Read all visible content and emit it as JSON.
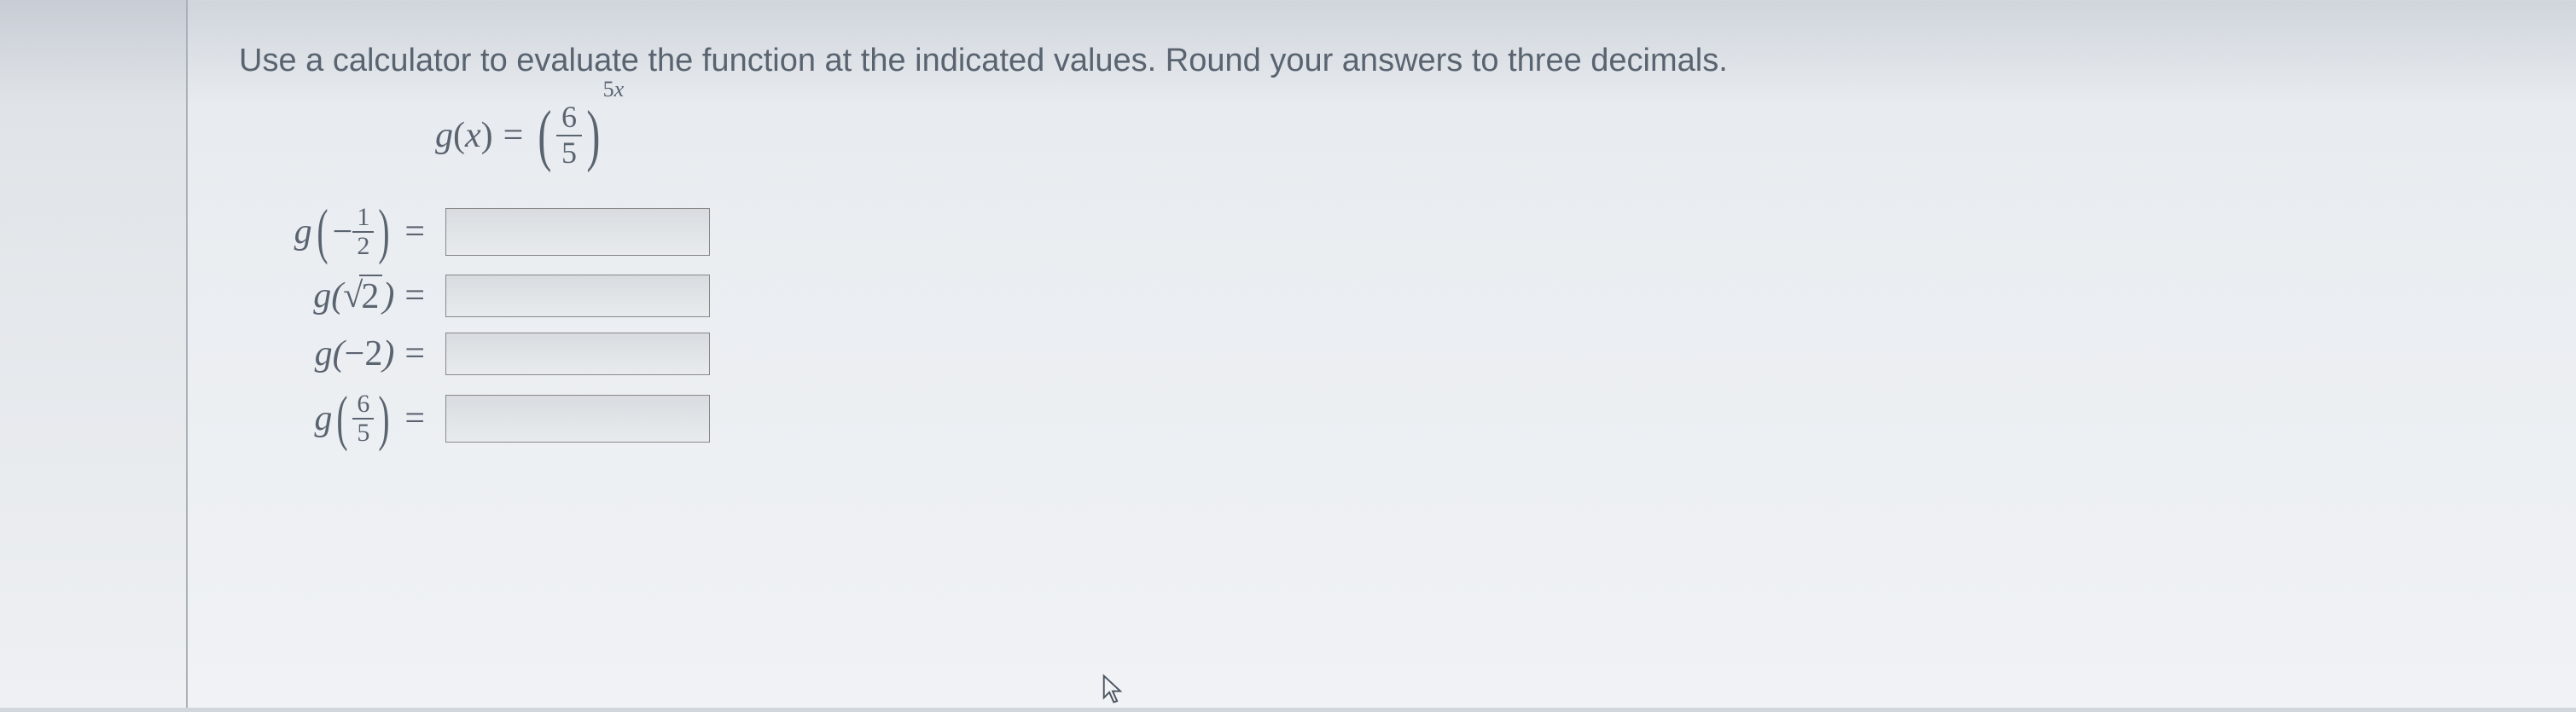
{
  "instruction": "Use a calculator to evaluate the function at the indicated values. Round your answers to three decimals.",
  "function": {
    "name": "g",
    "variable": "x",
    "base_num": "6",
    "base_den": "5",
    "exp_coeff": "5",
    "exp_var": "x"
  },
  "rows": [
    {
      "label_g": "g",
      "arg_type": "neg_frac",
      "neg": "−",
      "num": "1",
      "den": "2",
      "equals": "="
    },
    {
      "label_g": "g",
      "arg_type": "sqrt",
      "sqrt_arg": "2",
      "equals": "="
    },
    {
      "label_g": "g",
      "arg_type": "neg_int",
      "neg": "−",
      "val": "2",
      "equals": "="
    },
    {
      "label_g": "g",
      "arg_type": "frac",
      "num": "6",
      "den": "5",
      "equals": "="
    }
  ]
}
